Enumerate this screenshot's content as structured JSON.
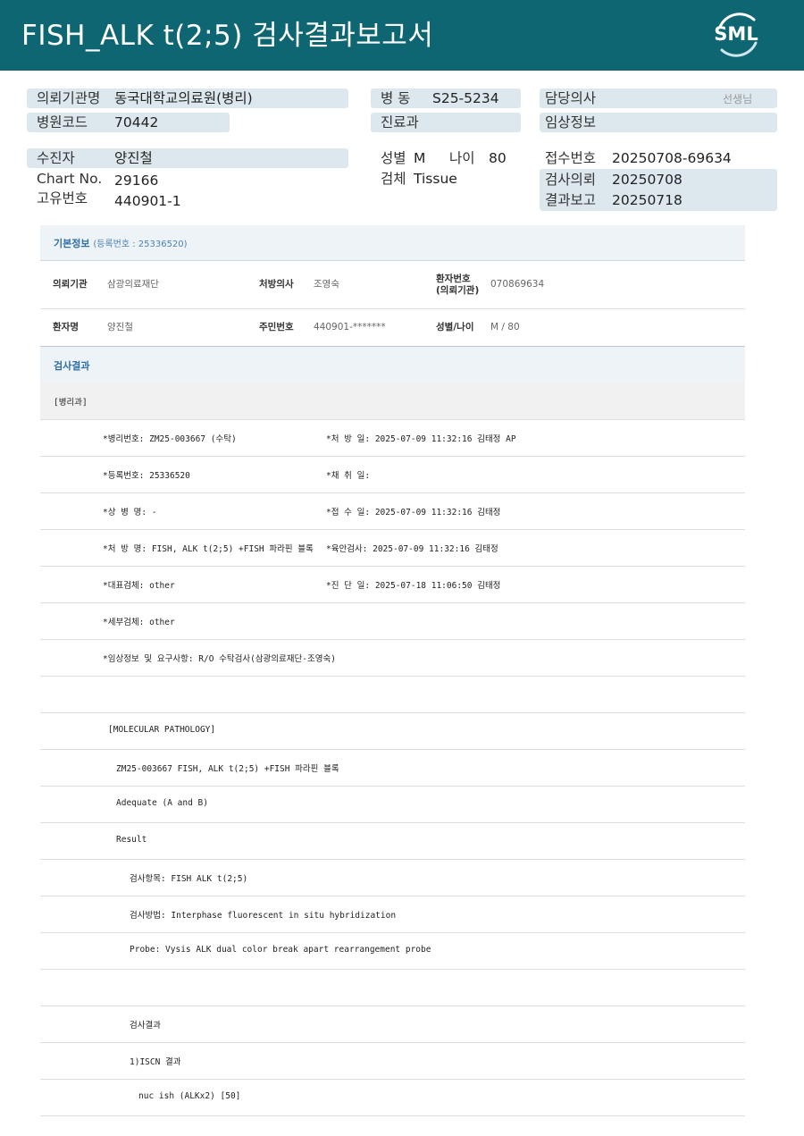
{
  "header": {
    "title": "FISH_ALK  t(2;5) 검사결과보고서",
    "logo_text": "SML"
  },
  "info": {
    "institution": {
      "label": "의뢰기관명",
      "value": "동국대학교의료원(병리)"
    },
    "hospital_code": {
      "label": "병원코드",
      "value": "70442"
    },
    "ward": {
      "label": "병  동",
      "value": "S25-5234"
    },
    "department": {
      "label": "진료과",
      "value": ""
    },
    "doctor": {
      "label": "담당의사",
      "value": "",
      "suffix": "선생님"
    },
    "clinical_info": {
      "label": "임상정보",
      "value": ""
    },
    "patient": {
      "label": "수진자",
      "value": "양진철"
    },
    "chart_no": {
      "label": "Chart No.",
      "value": "29166"
    },
    "unique_no": {
      "label": "고유번호",
      "value": "440901-1"
    },
    "sex": {
      "label": "성별",
      "value": "M"
    },
    "age": {
      "label": "나이",
      "value": "80"
    },
    "specimen": {
      "label": "검체",
      "value": "Tissue"
    },
    "receipt_no": {
      "label": "접수번호",
      "value": "20250708-69634"
    },
    "request_date": {
      "label": "검사의뢰",
      "value": "20250708"
    },
    "report_date": {
      "label": "결과보고",
      "value": "20250718"
    }
  },
  "basic": {
    "title": "기본정보",
    "reg": "(등록번호 : 25336520)",
    "row1": [
      {
        "k": "의뢰기관",
        "v": "삼광의료재단"
      },
      {
        "k": "처방의사",
        "v": "조영숙"
      },
      {
        "k1": "환자번호",
        "k2": "(의뢰기관)",
        "v": "070869634"
      }
    ],
    "row2": [
      {
        "k": "환자명",
        "v": "양진철"
      },
      {
        "k": "주민번호",
        "v": "440901-*******"
      },
      {
        "k": "성별/나이",
        "v": "M / 80"
      }
    ]
  },
  "result": {
    "title": "검사결과",
    "rows": [
      {
        "a": "[병리과]",
        "b": ""
      },
      {
        "a": "*병리번호: ZM25-003667 (수탁)",
        "b": "*처 방 일: 2025-07-09 11:32:16  김태정 AP"
      },
      {
        "a": "*등록번호: 25336520",
        "b": "*채 취 일:"
      },
      {
        "a": "*상 병 명: -",
        "b": "*접 수 일: 2025-07-09 11:32:16  김태정"
      },
      {
        "a": "*처 방 명: FISH, ALK t(2;5) +FISH 파라핀 블록",
        "b": "*육안검사: 2025-07-09 11:32:16  김태정"
      },
      {
        "a": "*대표검체: other",
        "b": "*진 단 일: 2025-07-18 11:06:50  김태정"
      },
      {
        "a": "*세부검체: other",
        "b": ""
      },
      {
        "a": "*임상정보 및 요구사항: R/O 수탁검사(삼광의료재단-조영숙)",
        "b": ""
      },
      {
        "a": "",
        "b": ""
      },
      {
        "a": "[MOLECULAR PATHOLOGY]",
        "b": ""
      },
      {
        "a": "ZM25-003667    FISH, ALK t(2;5) +FISH 파라핀 블록",
        "b": ""
      },
      {
        "a": "Adequate (A and B)",
        "b": ""
      },
      {
        "a": "Result",
        "b": ""
      },
      {
        "a": "검사항목: FISH ALK t(2;5)",
        "b": ""
      },
      {
        "a": "검사방법: Interphase fluorescent in situ hybridization",
        "b": ""
      },
      {
        "a": "Probe: Vysis ALK dual color break apart rearrangement probe",
        "b": ""
      },
      {
        "a": "",
        "b": ""
      },
      {
        "a": "검사결과",
        "b": ""
      },
      {
        "a": "1)ISCN 결과",
        "b": ""
      },
      {
        "a": "nuc ish (ALKx2) [50]",
        "b": ""
      }
    ]
  }
}
